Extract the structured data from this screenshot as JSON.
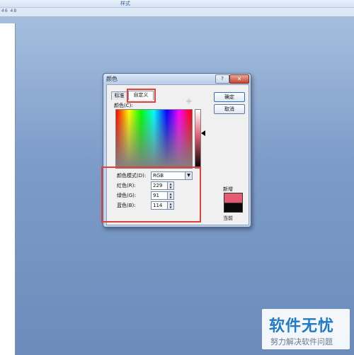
{
  "ribbon": {
    "label": "样式"
  },
  "ruler": {
    "numbers": "46  48"
  },
  "dialog": {
    "title": "颜色",
    "help_label": "?",
    "close_label": "✕",
    "tabs": [
      {
        "label": "标准",
        "selected": false
      },
      {
        "label": "自定义",
        "selected": true
      }
    ],
    "colors_label": "颜色(C):",
    "ok_label": "确定",
    "cancel_label": "取消",
    "color_model": {
      "label": "颜色模式(D):",
      "value": "RGB"
    },
    "red": {
      "label": "红色(R):",
      "value": "229"
    },
    "green": {
      "label": "绿色(G):",
      "value": "91"
    },
    "blue": {
      "label": "蓝色(B):",
      "value": "114"
    },
    "new_label": "新增",
    "current_label": "当前",
    "new_color": "#e55b72",
    "current_color": "#0a0a0a"
  },
  "watermark": {
    "logo": "软件无忧",
    "sub": "努力解决软件问题"
  }
}
